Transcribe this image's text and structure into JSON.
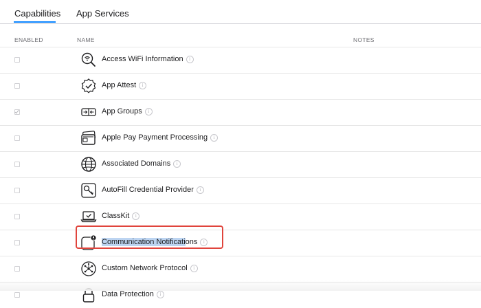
{
  "tabs": [
    {
      "label": "Capabilities",
      "active": true
    },
    {
      "label": "App Services",
      "active": false
    }
  ],
  "columns": {
    "enabled": "ENABLED",
    "name": "NAME",
    "notes": "NOTES"
  },
  "accent_color": "#0a84ff",
  "annotation_color": "#e0443c",
  "capabilities": [
    {
      "label": "Access WiFi Information",
      "enabled": false,
      "icon": "wifi-search-icon"
    },
    {
      "label": "App Attest",
      "enabled": false,
      "icon": "verified-badge-icon"
    },
    {
      "label": "App Groups",
      "enabled": true,
      "icon": "app-groups-icon"
    },
    {
      "label": "Apple Pay Payment Processing",
      "enabled": false,
      "icon": "wallet-cards-icon"
    },
    {
      "label": "Associated Domains",
      "enabled": false,
      "icon": "globe-icon"
    },
    {
      "label": "AutoFill Credential Provider",
      "enabled": false,
      "icon": "key-icon"
    },
    {
      "label": "ClassKit",
      "enabled": false,
      "icon": "laptop-check-icon"
    },
    {
      "label": "Communication Notifications",
      "label_selected_part": "Communication Notificati",
      "label_rest": "ons",
      "enabled": false,
      "icon": "notification-badge-icon"
    },
    {
      "label": "Custom Network Protocol",
      "enabled": false,
      "icon": "network-protocol-icon"
    },
    {
      "label": "Data Protection",
      "enabled": false,
      "icon": "lock-icon"
    }
  ]
}
